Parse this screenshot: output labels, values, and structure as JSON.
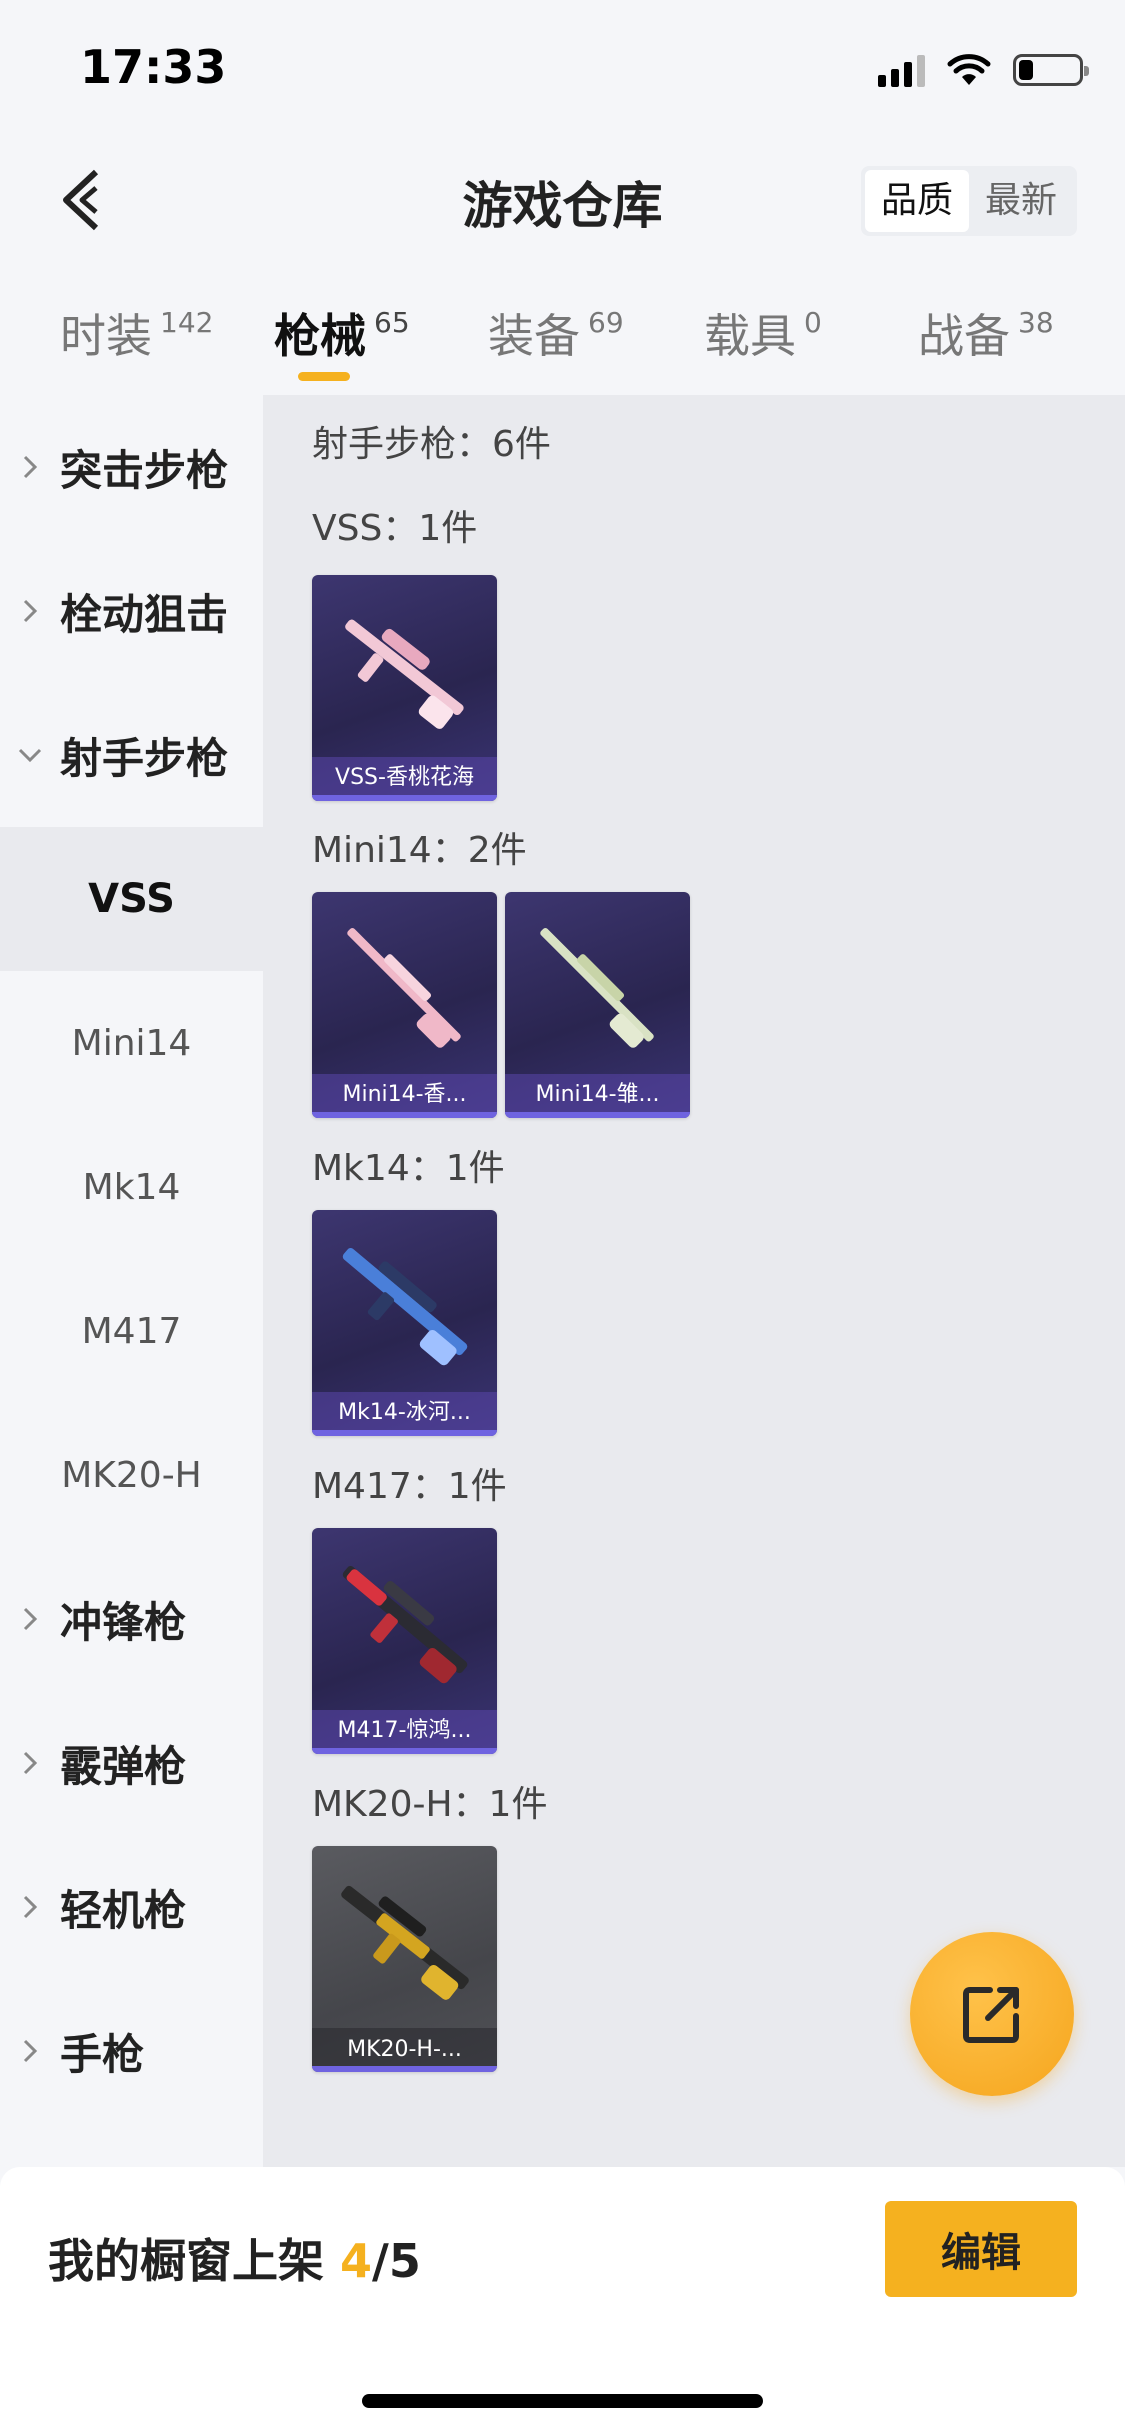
{
  "status": {
    "time": "17:33"
  },
  "header": {
    "title": "游戏仓库",
    "sort_options": [
      "品质",
      "最新"
    ],
    "active_sort": "品质"
  },
  "category_tabs": [
    {
      "label": "时装",
      "count": "142"
    },
    {
      "label": "枪械",
      "count": "65",
      "active": true
    },
    {
      "label": "装备",
      "count": "69"
    },
    {
      "label": "载具",
      "count": "0"
    },
    {
      "label": "战备",
      "count": "38"
    }
  ],
  "sidebar": {
    "groups_top": [
      "突击步枪",
      "栓动狙击",
      "射手步枪"
    ],
    "subitems": [
      "VSS",
      "Mini14",
      "Mk14",
      "M417",
      "MK20-H"
    ],
    "active_subitem": "VSS",
    "groups_bottom": [
      "冲锋枪",
      "霰弹枪",
      "轻机枪",
      "手枪"
    ]
  },
  "content": {
    "category_summary": "射手步枪：6件",
    "sections": [
      {
        "title": "VSS：1件",
        "items": [
          "VSS-香桃花海"
        ]
      },
      {
        "title": "Mini14：2件",
        "items": [
          "Mini14-香...",
          "Mini14-雏..."
        ]
      },
      {
        "title": "Mk14：1件",
        "items": [
          "Mk14-冰河..."
        ]
      },
      {
        "title": "M417：1件",
        "items": [
          "M417-惊鸿..."
        ]
      },
      {
        "title": "MK20-H：1件",
        "items": [
          "MK20-H-..."
        ]
      }
    ]
  },
  "footer": {
    "showcase_label": "我的橱窗上架",
    "showcase_count": "4",
    "showcase_total": "/5",
    "edit_label": "编辑"
  },
  "colors": {
    "accent": "#f5b11f",
    "card_bg": "#2a2550",
    "card_bar": "#6f63e0"
  }
}
